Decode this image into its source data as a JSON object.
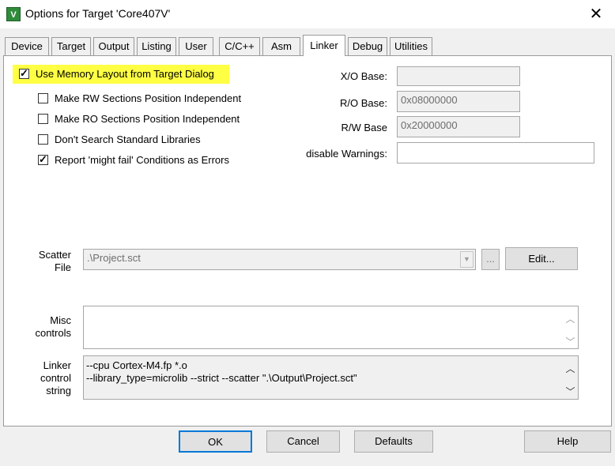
{
  "window": {
    "title": "Options for Target 'Core407V'",
    "app_icon_glyph": "V",
    "close_glyph": "✕"
  },
  "tabs": [
    "Device",
    "Target",
    "Output",
    "Listing",
    "User",
    "C/C++",
    "Asm",
    "Linker",
    "Debug",
    "Utilities"
  ],
  "active_tab": "Linker",
  "checkboxes": {
    "use_memory_layout": {
      "label": "Use Memory Layout from Target Dialog",
      "checked": true
    },
    "rw_independent": {
      "label": "Make RW Sections Position Independent",
      "checked": false
    },
    "ro_independent": {
      "label": "Make RO Sections Position Independent",
      "checked": false
    },
    "dont_search_libs": {
      "label": "Don't Search Standard Libraries",
      "checked": false
    },
    "report_might_fail": {
      "label": "Report 'might fail' Conditions as Errors",
      "checked": true
    }
  },
  "bases": {
    "xo_label": "X/O Base:",
    "xo_value": "",
    "ro_label": "R/O Base:",
    "ro_value": "0x08000000",
    "rw_label": "R/W Base",
    "rw_value": "0x20000000",
    "warnings_label": "disable Warnings:",
    "warnings_value": ""
  },
  "scatter": {
    "label_line1": "Scatter",
    "label_line2": "File",
    "value": ".\\Project.sct",
    "browse_label": "...",
    "edit_label": "Edit..."
  },
  "misc": {
    "label_line1": "Misc",
    "label_line2": "controls",
    "value": ""
  },
  "linker": {
    "label_line1": "Linker",
    "label_line2": "control",
    "label_line3": "string",
    "line1": "--cpu Cortex-M4.fp *.o",
    "line2": "--library_type=microlib --strict --scatter \".\\Output\\Project.sct\""
  },
  "footer": {
    "ok": "OK",
    "cancel": "Cancel",
    "defaults": "Defaults",
    "help": "Help"
  },
  "colors": {
    "highlight": "#ffff44",
    "dialog_bg": "#f0f0f0",
    "app_icon": "#2e8b3a"
  }
}
